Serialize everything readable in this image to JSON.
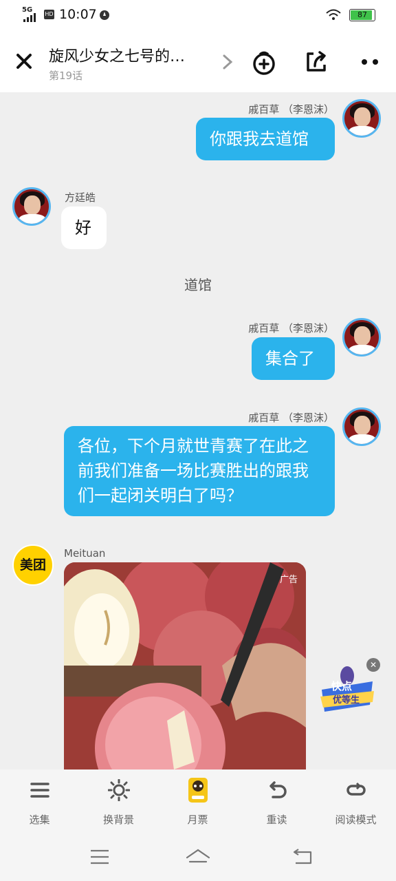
{
  "status_bar": {
    "network": "5G",
    "hd": "HD",
    "time": "10:07",
    "battery": "87"
  },
  "header": {
    "title": "旋风少女之七号的…",
    "episode": "第19话"
  },
  "messages": [
    {
      "speaker": "戚百草 （李恩沫）",
      "text": "你跟我去道馆"
    },
    {
      "speaker": "方廷皓",
      "text": "好"
    },
    {
      "scene": "道馆"
    },
    {
      "speaker": "戚百草 （李恩沫）",
      "text": "集合了"
    },
    {
      "speaker": "戚百草 （李恩沫）",
      "text": "各位，下个月就世青赛了在此之前我们准备一场比赛胜出的跟我们一起闭关明白了吗？"
    }
  ],
  "ad": {
    "brand_logo": "美团",
    "advertiser": "Meituan",
    "badge": "广告"
  },
  "float_widget": {
    "line1": "快点",
    "line2": "优等生"
  },
  "toolbar": [
    {
      "label": "选集",
      "icon": "list-icon"
    },
    {
      "label": "换背景",
      "icon": "sun-icon"
    },
    {
      "label": "月票",
      "icon": "ticket-icon"
    },
    {
      "label": "重读",
      "icon": "undo-icon"
    },
    {
      "label": "阅读模式",
      "icon": "loop-icon"
    }
  ],
  "colors": {
    "bubble": "#2bb3ec",
    "avatar_ring": "#56b6f0",
    "meituan": "#ffd100"
  }
}
